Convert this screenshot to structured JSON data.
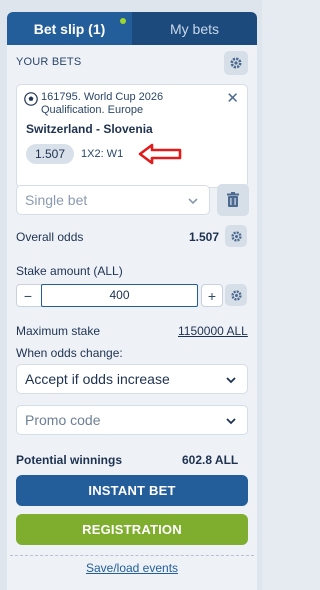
{
  "tabs": [
    {
      "label": "Bet slip (1)",
      "active": true,
      "has_dot": true
    },
    {
      "label": "My bets",
      "active": false
    }
  ],
  "section_title": "YOUR BETS",
  "bet": {
    "event_desc": "161795. World Cup 2026 Qualification. Europe",
    "teams": "Switzerland - Slovenia",
    "odds": "1.507",
    "market": "1X2: W1"
  },
  "bet_type": {
    "value": "Single bet"
  },
  "overall_odds": {
    "label": "Overall odds",
    "value": "1.507"
  },
  "stake": {
    "label": "Stake amount (ALL)",
    "value": "400",
    "minus": "−",
    "plus": "+"
  },
  "max_stake": {
    "label": "Maximum stake",
    "value": "1150000 ALL"
  },
  "odds_change": {
    "label": "When odds change:",
    "value": "Accept if odds increase"
  },
  "promo": {
    "placeholder": "Promo code"
  },
  "potential": {
    "label": "Potential winnings",
    "value": "602.8 ALL"
  },
  "buttons": {
    "instant": "INSTANT BET",
    "registration": "REGISTRATION"
  },
  "save_load": "Save/load events",
  "colors": {
    "primary": "#235e9a",
    "nav_dark": "#1c4a7c",
    "green": "#7fae2f",
    "annotation_red": "#e01b1b"
  }
}
